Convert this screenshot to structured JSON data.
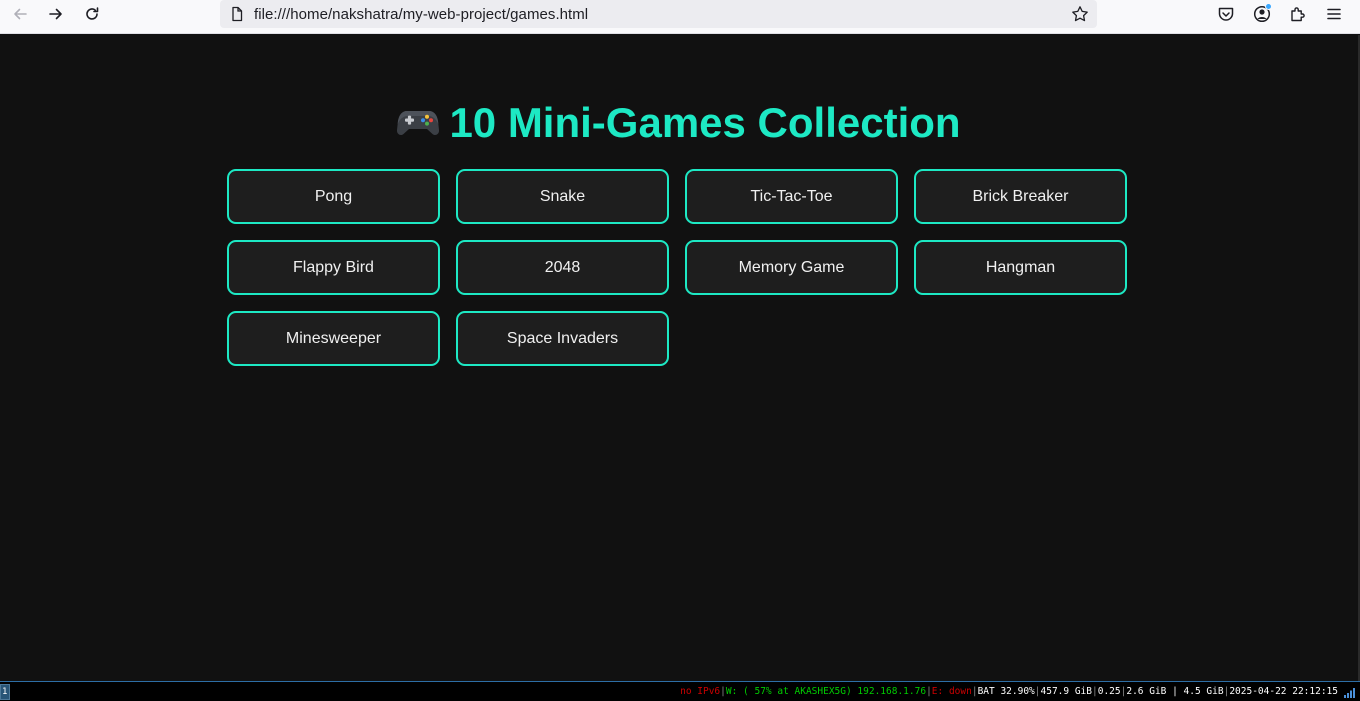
{
  "browser": {
    "url": "file:///home/nakshatra/my-web-project/games.html",
    "icons": [
      "back-icon",
      "forward-icon",
      "reload-icon",
      "page-icon",
      "bookmark-star-icon",
      "pocket-icon",
      "account-icon",
      "extensions-icon",
      "menu-icon"
    ]
  },
  "page": {
    "title_emoji": "game-controller-icon",
    "title": "10 Mini-Games Collection",
    "games": [
      "Pong",
      "Snake",
      "Tic-Tac-Toe",
      "Brick Breaker",
      "Flappy Bird",
      "2048",
      "Memory Game",
      "Hangman",
      "Minesweeper",
      "Space Invaders"
    ]
  },
  "statusbar": {
    "workspace": "1",
    "ipv6": "no IPv6",
    "wifi": "W: ( 57% at AKASHEX5G) 192.168.1.76",
    "ethernet": "E: down",
    "battery": "BAT 32.90%",
    "disk": "457.9 GiB",
    "load": "0.25",
    "memory": "2.6 GiB | 4.5 GiB",
    "datetime": "2025-04-22 22:12:15"
  },
  "colors": {
    "accent": "#1de9c4",
    "background": "#111111",
    "button_bg": "#1e1e1e",
    "status_red": "#cc0000",
    "status_green": "#00cc00"
  }
}
